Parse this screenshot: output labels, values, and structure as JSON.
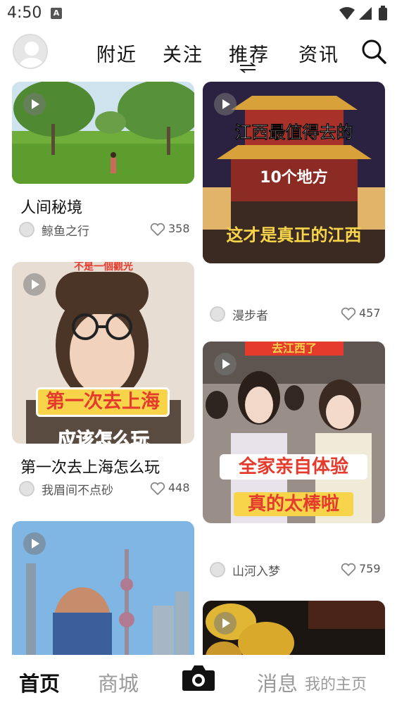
{
  "status_bar": {
    "time": "4:50",
    "notification_badge": "A"
  },
  "top_nav": {
    "tabs": [
      "附近",
      "关注",
      "推荐",
      "资讯"
    ],
    "active_tab": "推荐"
  },
  "feed": {
    "left": [
      {
        "title": "人间秘境",
        "author": "鲸鱼之行",
        "likes": "358",
        "thumb": "park-scene"
      },
      {
        "title": "第一次去上海怎么玩",
        "author": "我眉间不点砂",
        "likes": "448",
        "overlay": {
          "top": "不是一個觀光",
          "middle": "第一次去上海",
          "bottom": "应该怎么玩"
        }
      },
      {
        "thumb": "shanghai-skyline"
      }
    ],
    "right": [
      {
        "author": "漫步者",
        "likes": "457",
        "overlay": {
          "line1": "江西最值得去的",
          "line2": "10个地方",
          "line3": "这才是真正的江西"
        }
      },
      {
        "author": "山河入梦",
        "likes": "759",
        "overlay": {
          "top": "去江西了",
          "line1": "全家亲自体验",
          "line2": "真的太棒啦"
        }
      },
      {
        "thumb": "yellow-flowers"
      }
    ]
  },
  "bottom_nav": {
    "home": "首页",
    "mall": "商城",
    "messages": "消息",
    "profile": "我的主页"
  },
  "colors": {
    "text_primary": "#111111",
    "text_secondary": "#555555",
    "inactive_tab": "#9a9a9a",
    "overlay_yellow": "#f7d44a",
    "overlay_red": "#e43b2c"
  }
}
